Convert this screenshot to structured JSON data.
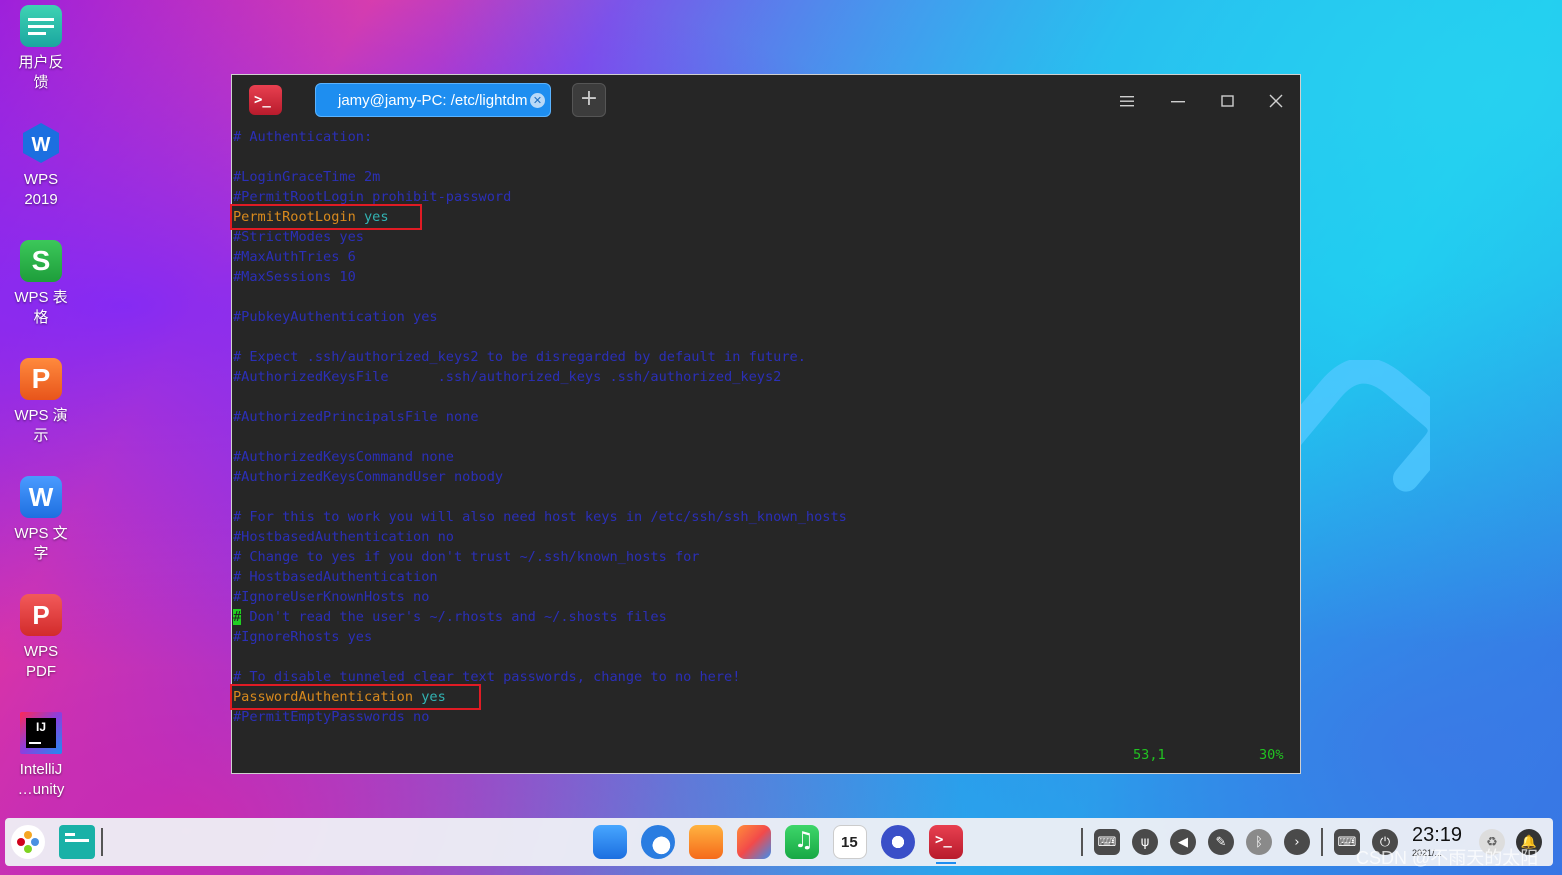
{
  "desktop": {
    "icons": [
      {
        "label_l1": "用户反",
        "label_l2": "馈"
      },
      {
        "label_l1": "WPS",
        "label_l2": "2019"
      },
      {
        "label_l1": "WPS 表",
        "label_l2": "格"
      },
      {
        "label_l1": "WPS 演",
        "label_l2": "示"
      },
      {
        "label_l1": "WPS 文",
        "label_l2": "字"
      },
      {
        "label_l1": "WPS",
        "label_l2": "PDF"
      },
      {
        "label_l1": "IntelliJ",
        "label_l2": "…unity"
      }
    ]
  },
  "window": {
    "tab_title": "jamy@jamy-PC: /etc/lightdm",
    "add_tab": "+"
  },
  "terminal": {
    "lines": [
      "# Authentication:",
      "",
      "#LoginGraceTime 2m",
      "#PermitRootLogin prohibit-password",
      "",
      "#StrictModes yes",
      "#MaxAuthTries 6",
      "#MaxSessions 10",
      "",
      "#PubkeyAuthentication yes",
      "",
      "# Expect .ssh/authorized_keys2 to be disregarded by default in future.",
      "#AuthorizedKeysFile      .ssh/authorized_keys .ssh/authorized_keys2",
      "",
      "#AuthorizedPrincipalsFile none",
      "",
      "#AuthorizedKeysCommand none",
      "#AuthorizedKeysCommandUser nobody",
      "",
      "# For this to work you will also need host keys in /etc/ssh/ssh_known_hosts",
      "#HostbasedAuthentication no",
      "# Change to yes if you don't trust ~/.ssh/known_hosts for",
      "# HostbasedAuthentication",
      "#IgnoreUserKnownHosts no",
      "",
      "#IgnoreRhosts yes",
      "",
      "# To disable tunneled clear text passwords, change to no here!",
      "",
      "#PermitEmptyPasswords no"
    ],
    "permit_root_key": "PermitRootLogin",
    "permit_root_val": "yes",
    "cursor_char": "#",
    "cursor_rest": " Don't read the user's ~/.rhosts and ~/.shosts files",
    "password_auth_key": "PasswordAuthentication",
    "password_auth_val": "yes",
    "status_position": "53,1",
    "status_percent": "30%"
  },
  "taskbar": {
    "time": "23:19",
    "date": "2021/...",
    "watermark": "CSDN @不雨天的太阳"
  }
}
